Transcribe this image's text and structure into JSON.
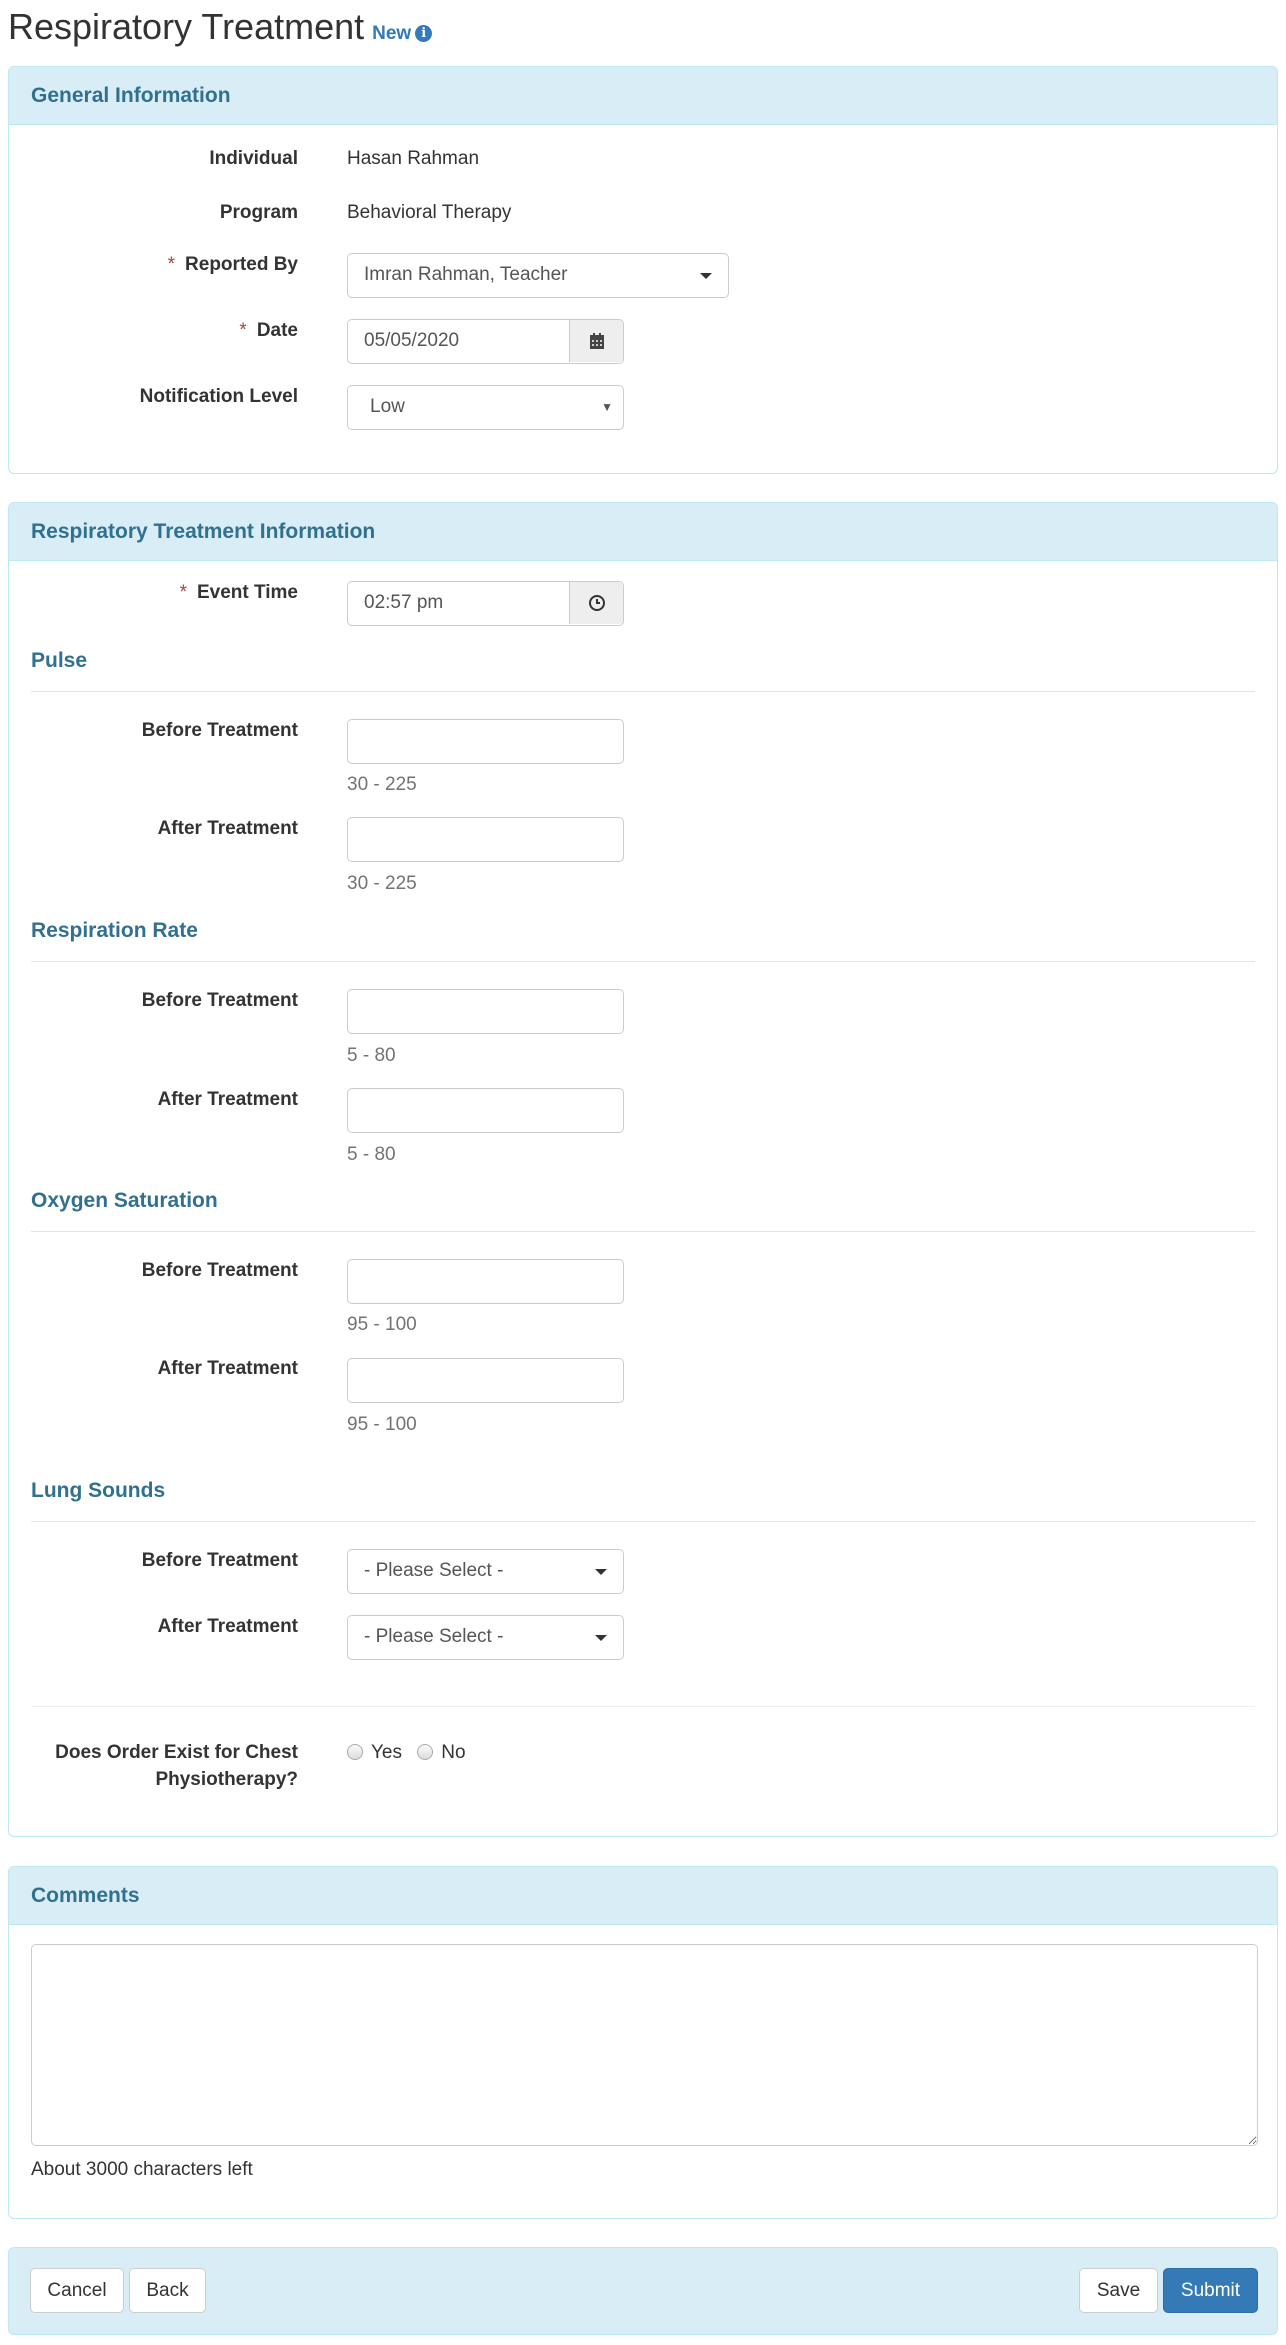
{
  "header": {
    "title": "Respiratory Treatment",
    "badge": "New",
    "info_icon": "info-circle-icon"
  },
  "general": {
    "heading": "General Information",
    "individual_label": "Individual",
    "individual_value": "Hasan Rahman",
    "program_label": "Program",
    "program_value": "Behavioral Therapy",
    "reported_by_label": "Reported By",
    "reported_by_value": "Imran Rahman, Teacher",
    "date_label": "Date",
    "date_value": "05/05/2020",
    "notification_label": "Notification Level",
    "notification_value": "Low",
    "required_marker": "*"
  },
  "treatment": {
    "heading": "Respiratory Treatment Information",
    "event_time_label": "Event Time",
    "event_time_value": "02:57 pm",
    "sections": [
      {
        "title": "Pulse",
        "before_label": "Before Treatment",
        "after_label": "After Treatment",
        "before_value": "",
        "after_value": "",
        "before_hint": "30 - 225",
        "after_hint": "30 - 225"
      },
      {
        "title": "Respiration Rate",
        "before_label": "Before Treatment",
        "after_label": "After Treatment",
        "before_value": "",
        "after_value": "",
        "before_hint": "5 - 80",
        "after_hint": "5 - 80"
      },
      {
        "title": "Oxygen Saturation",
        "before_label": "Before Treatment",
        "after_label": "After Treatment",
        "before_value": "",
        "after_value": "",
        "before_hint": "95 - 100",
        "after_hint": "95 - 100"
      }
    ],
    "lung_sounds": {
      "title": "Lung Sounds",
      "before_label": "Before Treatment",
      "after_label": "After Treatment",
      "before_value": "- Please Select -",
      "after_value": "- Please Select -"
    },
    "chest_order": {
      "label_line1": "Does Order Exist for Chest",
      "label_line2": "Physiotherapy?",
      "options": [
        "Yes",
        "No"
      ],
      "selected": null
    }
  },
  "comments": {
    "heading": "Comments",
    "value": "",
    "chars_left": "About 3000 characters left"
  },
  "footer": {
    "cancel": "Cancel",
    "back": "Back",
    "save": "Save",
    "submit": "Submit"
  },
  "colors": {
    "accent": "#337ab7",
    "panel_heading_bg": "#d9edf7",
    "panel_heading_text": "#31708f",
    "panel_border": "#bce8f1",
    "required": "#a94442"
  }
}
